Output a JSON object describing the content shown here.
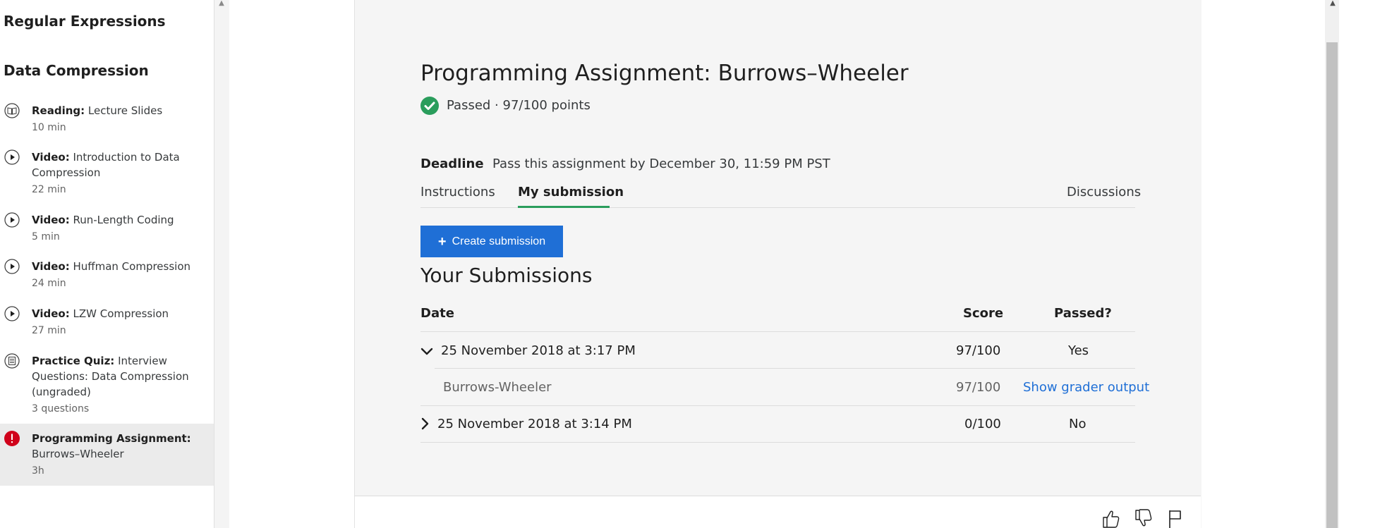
{
  "sidebar": {
    "sections": [
      {
        "title": "Regular Expressions"
      },
      {
        "title": "Data Compression"
      }
    ],
    "items": [
      {
        "type": "Reading:",
        "title": "Lecture Slides",
        "meta": "10 min",
        "icon": "book-icon"
      },
      {
        "type": "Video:",
        "title": "Introduction to Data Compression",
        "meta": "22 min",
        "icon": "play-icon"
      },
      {
        "type": "Video:",
        "title": "Run-Length Coding",
        "meta": "5 min",
        "icon": "play-icon"
      },
      {
        "type": "Video:",
        "title": "Huffman Compression",
        "meta": "24 min",
        "icon": "play-icon"
      },
      {
        "type": "Video:",
        "title": "LZW Compression",
        "meta": "27 min",
        "icon": "play-icon"
      },
      {
        "type": "Practice Quiz:",
        "title": "Interview Questions: Data Compression (ungraded)",
        "meta": "3 questions",
        "icon": "quiz-icon"
      },
      {
        "type": "Programming Assignment:",
        "title": "Burrows–Wheeler",
        "meta": "3h",
        "icon": "alert-icon",
        "active": true
      }
    ]
  },
  "assignment": {
    "title": "Programming Assignment: Burrows–Wheeler",
    "status": "Passed · 97/100 points",
    "status_icon": "check-circle-icon",
    "deadline_label": "Deadline",
    "deadline_text": "Pass this assignment by December 30, 11:59 PM PST"
  },
  "tabs": [
    {
      "label": "Instructions"
    },
    {
      "label": "My submission",
      "active": true
    },
    {
      "label": "Discussions"
    }
  ],
  "create_button": {
    "label": "Create submission",
    "icon": "plus-icon"
  },
  "submissions": {
    "title": "Your Submissions",
    "headers": {
      "date": "Date",
      "score": "Score",
      "passed": "Passed?"
    },
    "rows": [
      {
        "date": "25 November 2018 at 3:17 PM",
        "score": "97/100",
        "passed": "Yes",
        "expanded": true,
        "parts": [
          {
            "name": "Burrows-Wheeler",
            "score": "97/100",
            "link": "Show grader output"
          }
        ]
      },
      {
        "date": "25 November 2018 at 3:14 PM",
        "score": "0/100",
        "passed": "No",
        "expanded": false
      }
    ]
  },
  "footer_icons": [
    "thumbs-up-icon",
    "thumbs-down-icon",
    "flag-icon"
  ],
  "colors": {
    "accent_blue": "#1f6fd6",
    "pass_green": "#2a9d5c",
    "alert_red": "#d0021b",
    "card_bg": "#f5f5f5"
  }
}
